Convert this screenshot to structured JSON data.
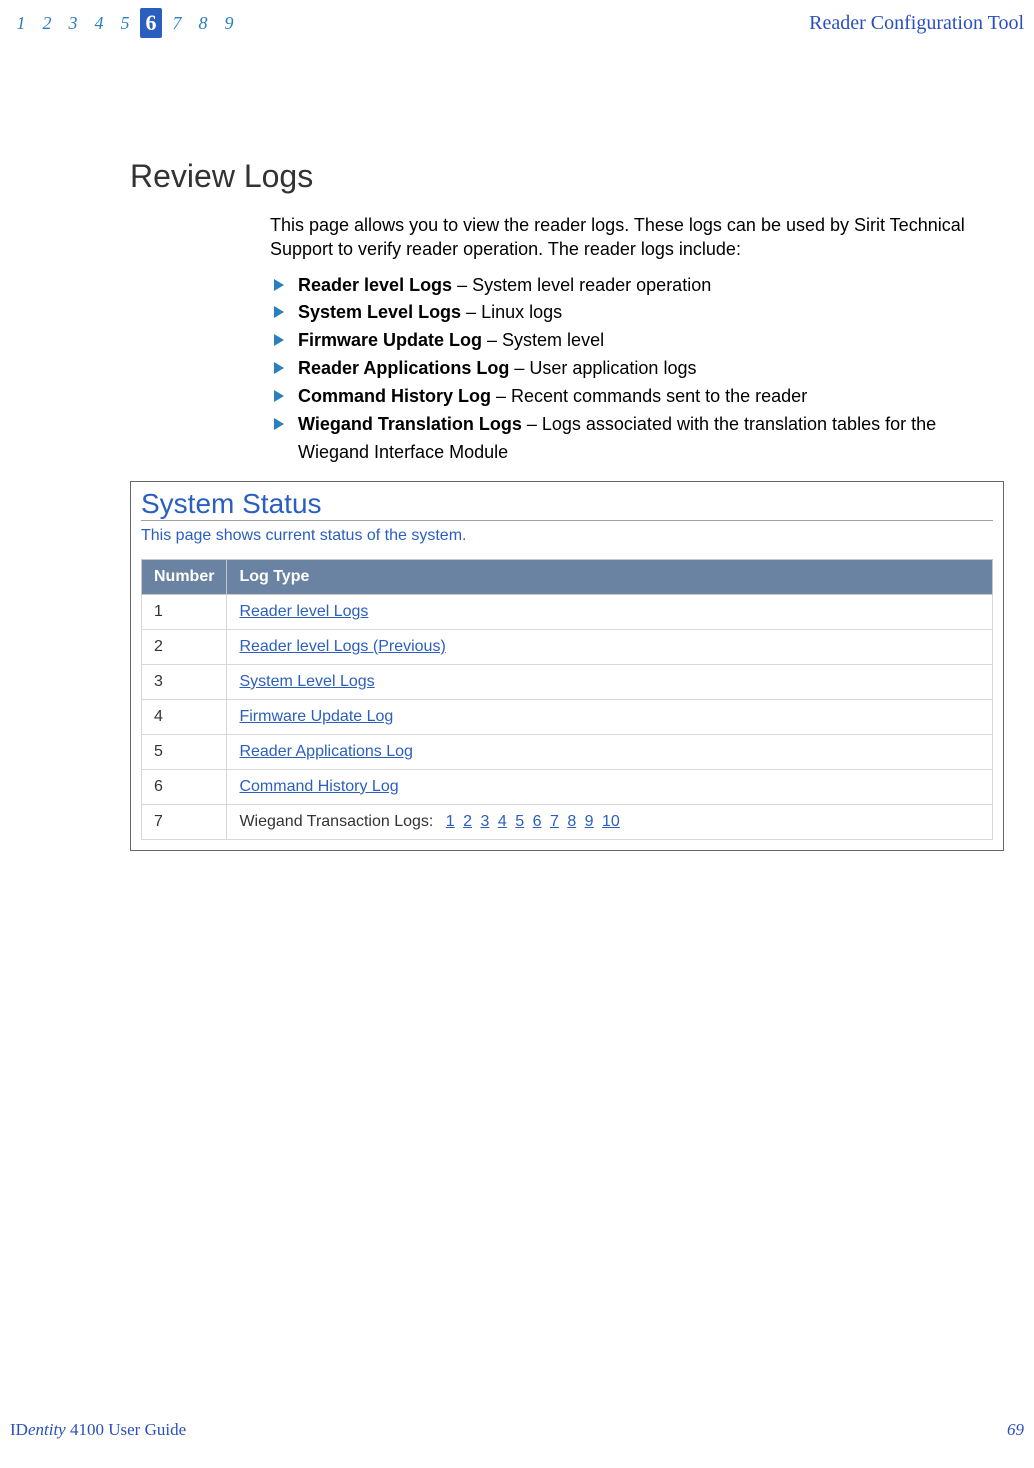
{
  "nav": {
    "items": [
      "1",
      "2",
      "3",
      "4",
      "5",
      "6",
      "7",
      "8",
      "9"
    ],
    "active_index": 5
  },
  "header": {
    "title": "Reader Configuration Tool"
  },
  "section": {
    "title": "Review Logs",
    "intro": "This page allows you to view the reader logs. These logs can be used by Sirit Technical Support to verify reader operation. The reader logs include:",
    "bullets": [
      {
        "bold": "Reader level Logs",
        "rest": " – System level reader operation"
      },
      {
        "bold": "System Level Logs",
        "rest": " – Linux logs"
      },
      {
        "bold": "Firmware Update Log",
        "rest": " – System level"
      },
      {
        "bold": "Reader Applications Log",
        "rest": " – User application logs"
      },
      {
        "bold": "Command History Log",
        "rest": " – Recent commands sent to the reader"
      },
      {
        "bold": "Wiegand Translation Logs",
        "rest": " – Logs associated with the translation tables for the Wiegand Interface Module"
      }
    ]
  },
  "screenshot": {
    "title": "System Status",
    "desc": "This page shows current status of the system.",
    "columns": {
      "number": "Number",
      "log_type": "Log Type"
    },
    "rows": [
      {
        "num": "1",
        "type": "link",
        "label": "Reader level Logs"
      },
      {
        "num": "2",
        "type": "link",
        "label": "Reader level Logs (Previous)"
      },
      {
        "num": "3",
        "type": "link",
        "label": "System Level Logs"
      },
      {
        "num": "4",
        "type": "link",
        "label": "Firmware Update Log"
      },
      {
        "num": "5",
        "type": "link",
        "label": "Reader Applications Log"
      },
      {
        "num": "6",
        "type": "link",
        "label": "Command History Log"
      },
      {
        "num": "7",
        "type": "wiegand",
        "prefix": "Wiegand Transaction Logs:",
        "links": [
          "1",
          "2",
          "3",
          "4",
          "5",
          "6",
          "7",
          "8",
          "9",
          "10"
        ]
      }
    ]
  },
  "footer": {
    "left_prefix": "ID",
    "left_italic": "entity",
    "left_suffix": " 4100 User Guide",
    "page": "69"
  }
}
